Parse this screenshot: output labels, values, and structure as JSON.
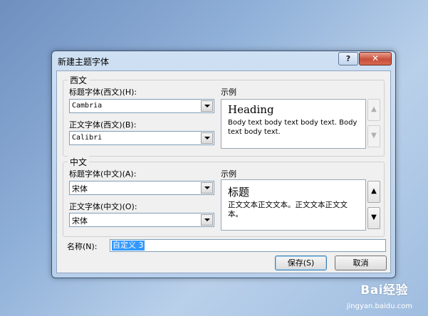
{
  "dialog": {
    "title": "新建主题字体",
    "help_label": "?",
    "close_label": "✕"
  },
  "western": {
    "group_label": "西文",
    "heading_font_label": "标题字体(西文)(H):",
    "heading_font_value": "Cambria",
    "body_font_label": "正文字体(西文)(B):",
    "body_font_value": "Calibri",
    "sample_label": "示例",
    "sample_heading": "Heading",
    "sample_body": "Body text body text body text. Body text body text."
  },
  "chinese": {
    "group_label": "中文",
    "heading_font_label": "标题字体(中文)(A):",
    "heading_font_value": "宋体",
    "body_font_label": "正文字体(中文)(O):",
    "body_font_value": "宋体",
    "sample_label": "示例",
    "sample_heading": "标题",
    "sample_body": "正文文本正文文本。正文文本正文文本。"
  },
  "name": {
    "label": "名称(N):",
    "value": "自定义 3"
  },
  "buttons": {
    "save_label": "保存(S)",
    "cancel_label": "取消"
  },
  "spin": {
    "up": "▲",
    "down": "▼"
  },
  "watermark": {
    "brand": "Bai经验",
    "url": "jingyan.baidu.com"
  }
}
